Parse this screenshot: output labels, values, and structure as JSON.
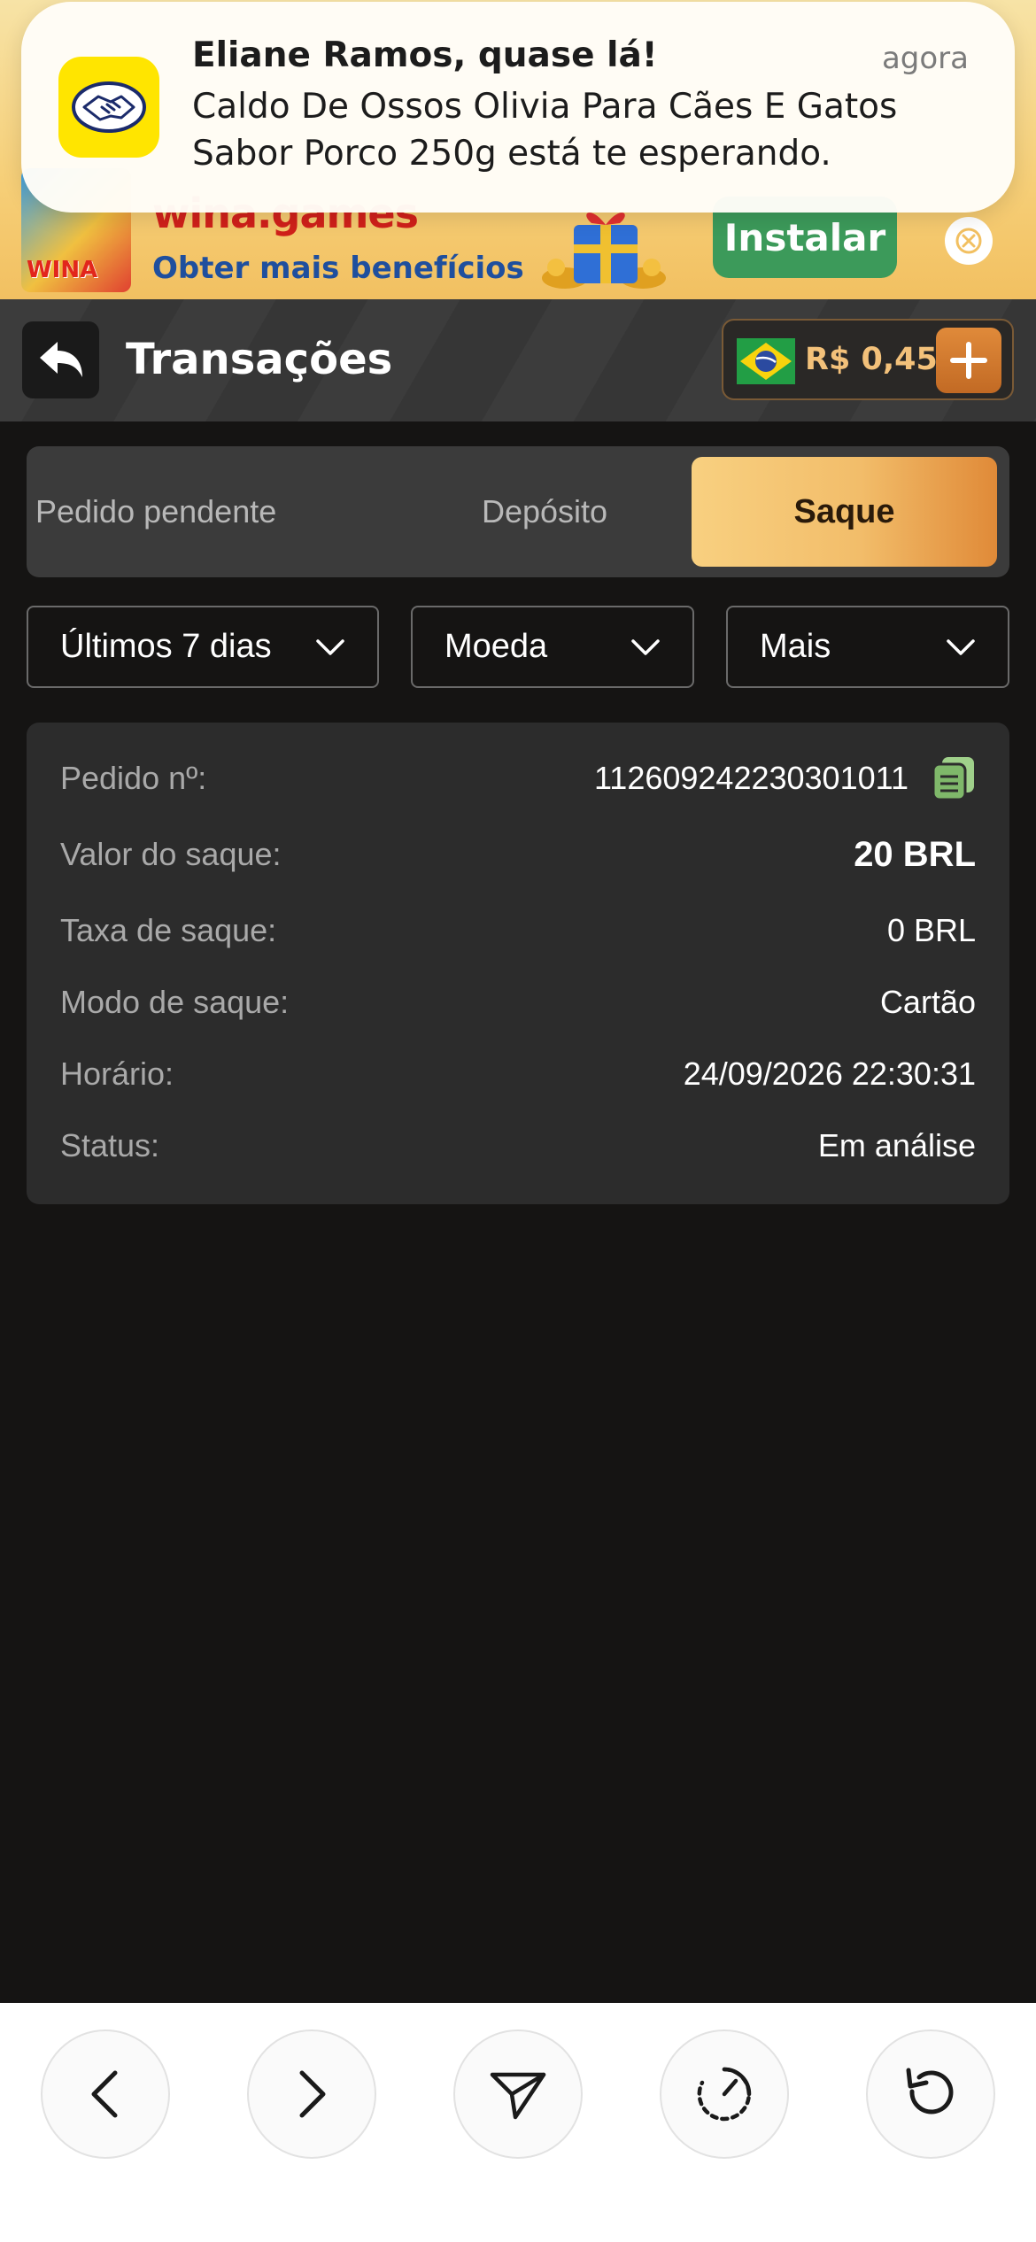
{
  "notification": {
    "title": "Eliane Ramos, quase lá!",
    "time": "agora",
    "body": "Caldo De Ossos Olivia Para Cães E Gatos Sabor Porco 250g está te esperando.",
    "icon": "handshake-icon",
    "icon_color": "#ffe500"
  },
  "ad": {
    "brand": "wina.games",
    "tagline": "Obter mais benefícios",
    "logo_text": "WINA",
    "install_label": "Instalar",
    "install_color": "#3c9a5a"
  },
  "header": {
    "title": "Transações",
    "balance": "R$ 0,45",
    "flag": "brazil-flag-icon",
    "accent": "#f3c17a"
  },
  "tabs": [
    {
      "label": "Pedido pendente",
      "active": false
    },
    {
      "label": "Depósito",
      "active": false
    },
    {
      "label": "Saque",
      "active": true
    }
  ],
  "filters": [
    {
      "label": "Últimos 7 dias"
    },
    {
      "label": "Moeda"
    },
    {
      "label": "Mais"
    }
  ],
  "transaction": {
    "order_label": "Pedido nº:",
    "order_value": "112609242230301011",
    "amount_label": "Valor do saque:",
    "amount_value": "20 BRL",
    "fee_label": "Taxa de saque:",
    "fee_value": "0 BRL",
    "mode_label": "Modo de saque:",
    "mode_value": "Cartão",
    "time_label": "Horário:",
    "time_value": "24/09/2026 22:30:31",
    "status_label": "Status:",
    "status_value": "Em análise"
  },
  "bottom_bar": {
    "buttons": [
      "back-icon",
      "forward-icon",
      "share-icon",
      "speed-icon",
      "reload-icon"
    ]
  }
}
